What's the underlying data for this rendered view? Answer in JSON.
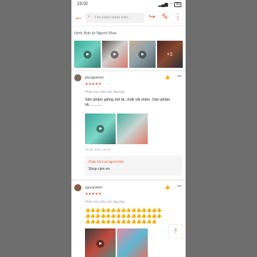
{
  "status_bar": {
    "time": "23:02",
    "battery": "65"
  },
  "header": {
    "search_placeholder": "Tìm kiếm thêm trên..."
  },
  "gallery": {
    "title": "Hình Ảnh từ Người Mua",
    "more_count": "+1"
  },
  "reviews": [
    {
      "user": "phongkimkim",
      "stars": "★★★★★",
      "variant": "Phân loại: Màu sắc,3kg-6kg",
      "text": "Sản phẩm giống mô tả, chất vải mềm. Sản phẩm ok............",
      "date": "29-05-2021 19:32",
      "reply_label": "Phản hồi của Người bán:",
      "reply_text": "Shop cảm ơn"
    },
    {
      "user": "ngocanh837",
      "stars": "★★★★★",
      "variant": "Phân loại: Màu sắc,3kg-6kg",
      "emoji_line_1": "👍👍👍👍👍👍👍👍👍👍👍👍👍👍👍",
      "emoji_line_2": "👍👍👍👍👍👍👍👍👍👍👍👍👍👍👍",
      "emoji_line_3": "👍👍👍👍👍👍👍👍👍👍👍👍👍👍"
    }
  ],
  "colors": {
    "accent": "#ee4d2d",
    "frame": "#6e6e6e"
  }
}
